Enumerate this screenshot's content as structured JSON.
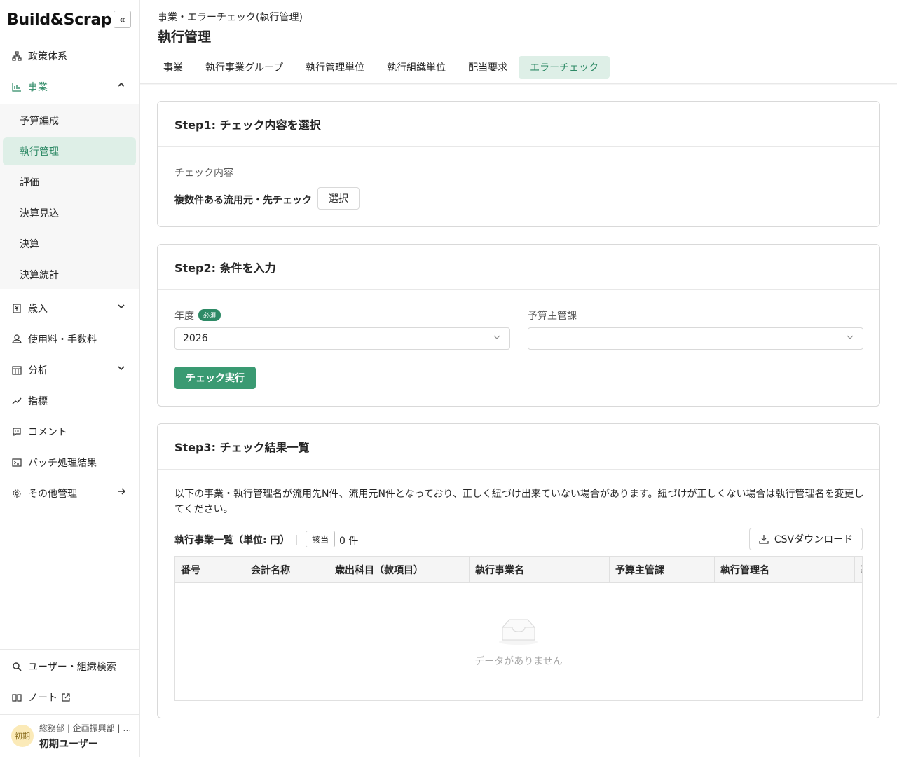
{
  "app": {
    "logo": "Build&Scrap",
    "collapse_icon": "«"
  },
  "sidebar": {
    "items": [
      {
        "label": "政策体系",
        "icon": "sitemap-icon"
      },
      {
        "label": "事業",
        "icon": "bar-chart-icon",
        "arrow": "⌃"
      },
      {
        "label": "歳入",
        "icon": "receipt-icon",
        "arrow": "⌄"
      },
      {
        "label": "使用料・手数料",
        "icon": "coins-icon"
      },
      {
        "label": "分析",
        "icon": "calendar-icon",
        "arrow": "⌄"
      },
      {
        "label": "指標",
        "icon": "trend-icon"
      },
      {
        "label": "コメント",
        "icon": "comment-icon"
      },
      {
        "label": "バッチ処理結果",
        "icon": "terminal-icon"
      },
      {
        "label": "その他管理",
        "icon": "gear-icon",
        "arrow": "→"
      }
    ],
    "sub_items": [
      "予算編成",
      "執行管理",
      "評価",
      "決算見込",
      "決算",
      "決算統計"
    ],
    "bottom_items": [
      {
        "label": "ユーザー・組織検索",
        "icon": "search-icon"
      },
      {
        "label": "ノート",
        "icon": "book-icon"
      }
    ],
    "user": {
      "avatar": "初期",
      "org": "総務部 | 企画振興部 | …",
      "name": "初期ユーザー"
    }
  },
  "header": {
    "breadcrumb": "事業・エラーチェック(執行管理)",
    "title": "執行管理",
    "tabs": [
      "事業",
      "執行事業グループ",
      "執行管理単位",
      "執行組織単位",
      "配当要求",
      "エラーチェック"
    ]
  },
  "step1": {
    "title": "Step1: チェック内容を選択",
    "field_label": "チェック内容",
    "value": "複数件ある流用元・先チェック",
    "select_button": "選択"
  },
  "step2": {
    "title": "Step2: 条件を入力",
    "year_label": "年度",
    "required_tag": "必須",
    "year_value": "2026",
    "dept_label": "予算主管課",
    "dept_value": "",
    "run_button": "チェック実行"
  },
  "step3": {
    "title": "Step3: チェック結果一覧",
    "description": "以下の事業・執行管理名が流用先N件、流用元N件となっており、正しく紐づけ出来ていない場合があります。紐づけが正しくない場合は執行管理名を変更してください。",
    "list_title": "執行事業一覧（単位: 円）",
    "count_tag": "該当",
    "count": "0 件",
    "csv_button": "CSVダウンロード",
    "columns": [
      "番号",
      "会計名称",
      "歳出科目（款項目）",
      "執行事業名",
      "予算主管課",
      "執行管理名",
      "事"
    ],
    "empty_text": "データがありません"
  },
  "colors": {
    "accent": "#2e8a66",
    "primary_button": "#3a9a72",
    "active_bg": "#deefe7"
  }
}
